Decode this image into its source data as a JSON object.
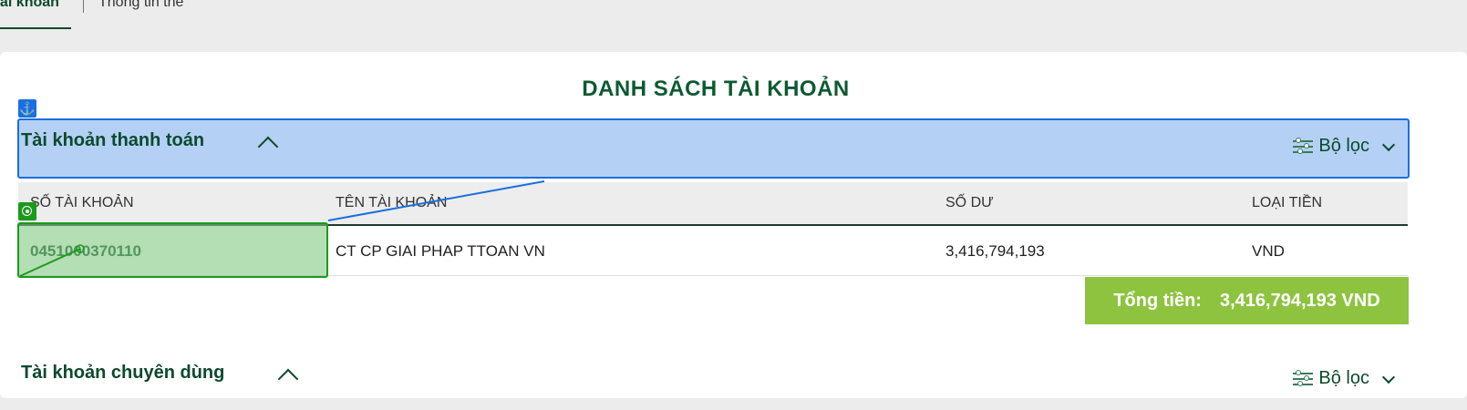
{
  "tabs": {
    "active": "ài khoản",
    "inactive": "Thông tin thẻ"
  },
  "page_title": "DANH SÁCH TÀI KHOẢN",
  "section_payment": {
    "title": "Tài khoản thanh toán",
    "filter_label": "Bộ lọc"
  },
  "table": {
    "columns": [
      "SỐ TÀI KHOẢN",
      "TÊN TÀI KHOẢN",
      "SỐ DƯ",
      "LOẠI TIỀN"
    ],
    "rows": [
      {
        "account_number": "0451000370110",
        "account_name": "CT CP GIAI PHAP TTOAN VN",
        "balance": "3,416,794,193",
        "currency": "VND"
      }
    ]
  },
  "total": {
    "label": "Tổng tiền:",
    "value": "3,416,794,193 VND"
  },
  "section_special": {
    "title": "Tài khoản chuyên dùng",
    "filter_label": "Bộ lọc"
  },
  "overlay_badges": {
    "anchor_icon": "anchor-icon",
    "target_icon": "target-icon"
  },
  "colors": {
    "brand_green": "#0c4a2c",
    "total_bg": "#8dc33f",
    "highlight_blue": "#1a6fe0",
    "highlight_green": "#1c9a1c"
  }
}
